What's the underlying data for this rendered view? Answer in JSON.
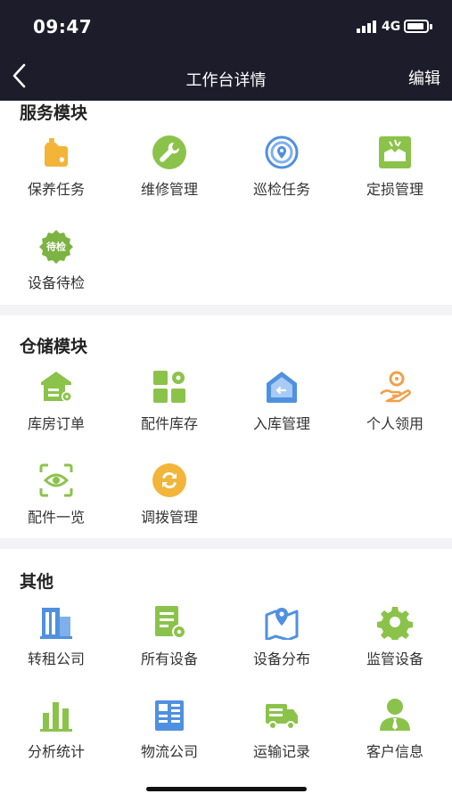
{
  "status_bar": {
    "time": "09:47",
    "network": "4G"
  },
  "nav": {
    "title": "工作台详情",
    "edit_label": "编辑"
  },
  "sections": [
    {
      "title": "服务模块",
      "items": [
        {
          "label": "保养任务",
          "icon": "oil-can-icon",
          "color": "#f2b53a"
        },
        {
          "label": "维修管理",
          "icon": "wrench-icon",
          "color": "#8bc34a"
        },
        {
          "label": "巡检任务",
          "icon": "location-target-icon",
          "color": "#4f90e0"
        },
        {
          "label": "定损管理",
          "icon": "broken-box-icon",
          "color": "#8bc34a"
        },
        {
          "label": "设备待检",
          "icon": "pending-inspection-badge-icon",
          "color": "#7cb342",
          "badge_text": "待检"
        }
      ]
    },
    {
      "title": "仓储模块",
      "items": [
        {
          "label": "库房订单",
          "icon": "warehouse-gear-icon",
          "color": "#8bc34a"
        },
        {
          "label": "配件库存",
          "icon": "parts-grid-icon",
          "color": "#8bc34a"
        },
        {
          "label": "入库管理",
          "icon": "warehouse-inbound-icon",
          "color": "#4f90e0"
        },
        {
          "label": "个人领用",
          "icon": "hand-gear-icon",
          "color": "#f0a04b"
        },
        {
          "label": "配件一览",
          "icon": "eye-scan-icon",
          "color": "#8bc34a"
        },
        {
          "label": "调拨管理",
          "icon": "transfer-cycle-icon",
          "color": "#f2b53a"
        }
      ]
    },
    {
      "title": "其他",
      "items": [
        {
          "label": "转租公司",
          "icon": "building-icon",
          "color": "#4f90e0"
        },
        {
          "label": "所有设备",
          "icon": "device-doc-icon",
          "color": "#8bc34a"
        },
        {
          "label": "设备分布",
          "icon": "map-pin-icon",
          "color": "#4f90e0"
        },
        {
          "label": "监管设备",
          "icon": "gear-icon",
          "color": "#8bc34a"
        },
        {
          "label": "分析统计",
          "icon": "bar-chart-icon",
          "color": "#8bc34a"
        },
        {
          "label": "物流公司",
          "icon": "office-building-icon",
          "color": "#4f90e0"
        },
        {
          "label": "运输记录",
          "icon": "truck-icon",
          "color": "#8bc34a"
        },
        {
          "label": "客户信息",
          "icon": "person-icon",
          "color": "#8bc34a"
        }
      ]
    }
  ]
}
